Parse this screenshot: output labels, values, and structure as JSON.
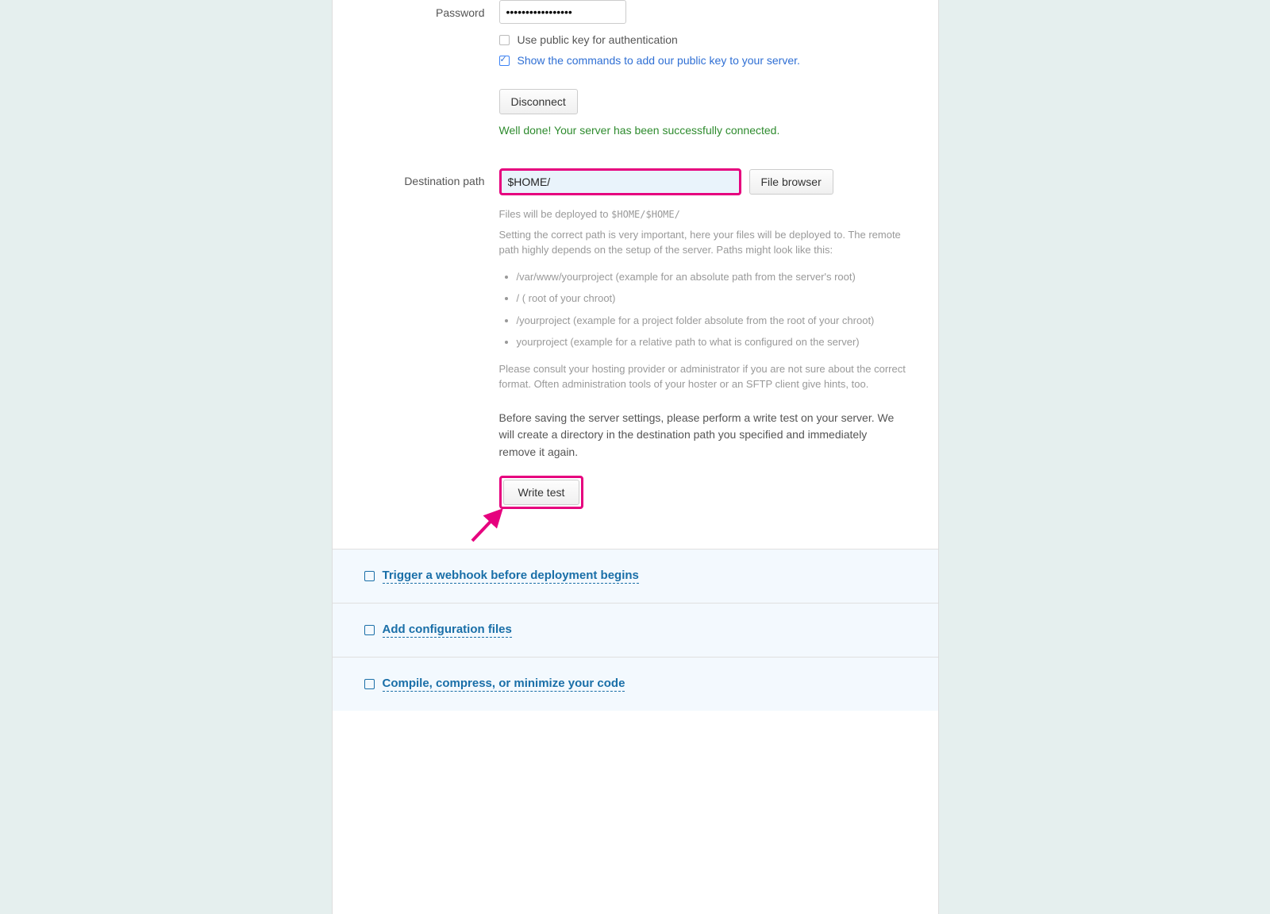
{
  "form": {
    "password": {
      "label": "Password",
      "value": "•••••••••••••••••"
    },
    "public_key_checkbox_label": "Use public key for authentication",
    "show_commands_link": "Show the commands to add our public key to your server.",
    "disconnect_button": "Disconnect",
    "success_message": "Well done! Your server has been successfully connected.",
    "destination": {
      "label": "Destination path",
      "value": "$HOME/",
      "file_browser_button": "File browser",
      "deploy_hint_prefix": "Files will be deployed to ",
      "deploy_hint_path": "$HOME/$HOME/",
      "path_explanation": "Setting the correct path is very important, here your files will be deployed to. The remote path highly depends on the setup of the server. Paths might look like this:",
      "examples": [
        "/var/www/yourproject (example for an absolute path from the server's root)",
        "/ ( root of your chroot)",
        "/yourproject (example for a project folder absolute from the root of your chroot)",
        "yourproject (example for a relative path to what is configured on the server)"
      ],
      "consult_hint": "Please consult your hosting provider or administrator if you are not sure about the correct format. Often administration tools of your hoster or an SFTP client give hints, too.",
      "write_test_intro": "Before saving the server settings, please perform a write test on your server. We will create a directory in the destination path you specified and immediately remove it again.",
      "write_test_button": "Write test"
    }
  },
  "accordion": {
    "items": [
      {
        "title": "Trigger a webhook before deployment begins"
      },
      {
        "title": "Add configuration files"
      },
      {
        "title": "Compile, compress, or minimize your code"
      }
    ]
  }
}
